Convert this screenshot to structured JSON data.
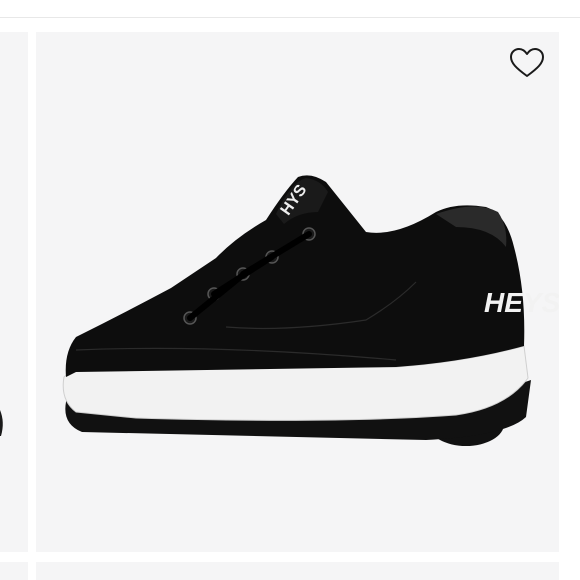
{
  "product": {
    "brand_text": "HEYS",
    "colors": {
      "card_bg": "#f5f5f6",
      "shoe_upper": "#0d0d0d",
      "sole_white": "#f2f2f2",
      "wheel": "#151515"
    }
  },
  "icons": {
    "wishlist": "heart-outline-icon"
  }
}
